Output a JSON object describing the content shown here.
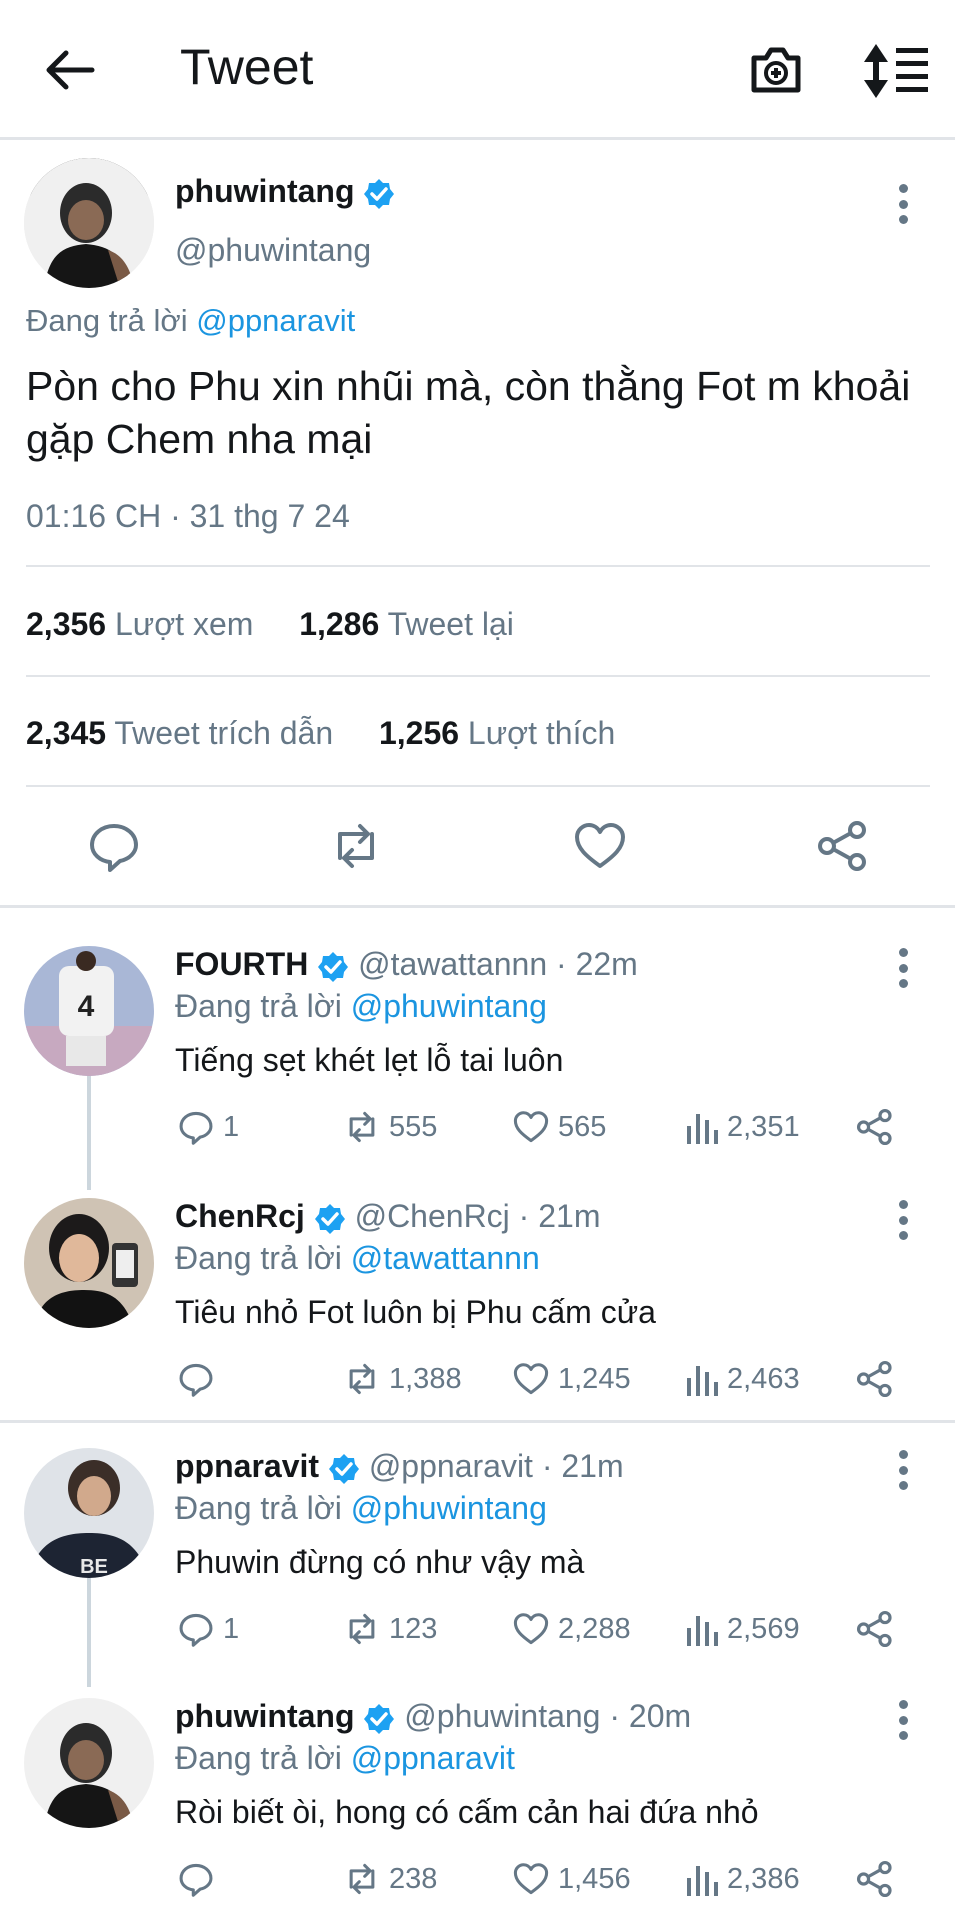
{
  "header": {
    "title": "Tweet"
  },
  "main_tweet": {
    "name": "phuwintang",
    "handle": "@phuwintang",
    "reply_prefix": "Đang trả lời ",
    "reply_to": "@ppnaravit",
    "text": "Pòn cho Phu xin nhũi mà, còn thằng Fot m khoải gặp Chem nha mại",
    "timestamp": "01:16 CH · 31 thg 7 24",
    "stats": {
      "views": "2,356",
      "views_label": "Lượt xem",
      "retweets": "1,286",
      "retweets_label": "Tweet lại",
      "quotes": "2,345",
      "quotes_label": "Tweet trích dẫn",
      "likes": "1,256",
      "likes_label": "Lượt thích"
    }
  },
  "replies": [
    {
      "name": "FOURTH",
      "handle": "@tawattannn · 22m",
      "reply_prefix": "Đang trả lời ",
      "reply_to": "@phuwintang",
      "text": "Tiếng sẹt khét lẹt lỗ tai luôn",
      "replies": "1",
      "retweets": "555",
      "likes": "565",
      "views": "2,351"
    },
    {
      "name": "ChenRcj",
      "handle": "@ChenRcj · 21m",
      "reply_prefix": "Đang trả lời ",
      "reply_to": "@tawattannn",
      "text": "Tiêu nhỏ Fot luôn bị Phu cấm cửa",
      "replies": "",
      "retweets": "1,388",
      "likes": "1,245",
      "views": "2,463"
    },
    {
      "name": "ppnaravit",
      "handle": "@ppnaravit · 21m",
      "reply_prefix": "Đang trả lời ",
      "reply_to": "@phuwintang",
      "text": "Phuwin đừng có như vậy mà",
      "replies": "1",
      "retweets": "123",
      "likes": "2,288",
      "views": "2,569"
    },
    {
      "name": "phuwintang",
      "handle": "@phuwintang · 20m",
      "reply_prefix": "Đang trả lời ",
      "reply_to": "@ppnaravit",
      "text": "Ròi biết òi, hong có cấm cản hai đứa nhỏ",
      "replies": "",
      "retweets": "238",
      "likes": "1,456",
      "views": "2,386"
    }
  ],
  "colors": {
    "accent": "#1b95e0",
    "muted": "#657786",
    "divider": "#e1e4e8",
    "verified": "#1da1f2"
  },
  "icons": [
    "back-arrow-icon",
    "camera-icon",
    "sort-icon",
    "more-icon",
    "reply-icon",
    "retweet-icon",
    "like-icon",
    "share-icon",
    "views-icon",
    "verified-icon"
  ]
}
